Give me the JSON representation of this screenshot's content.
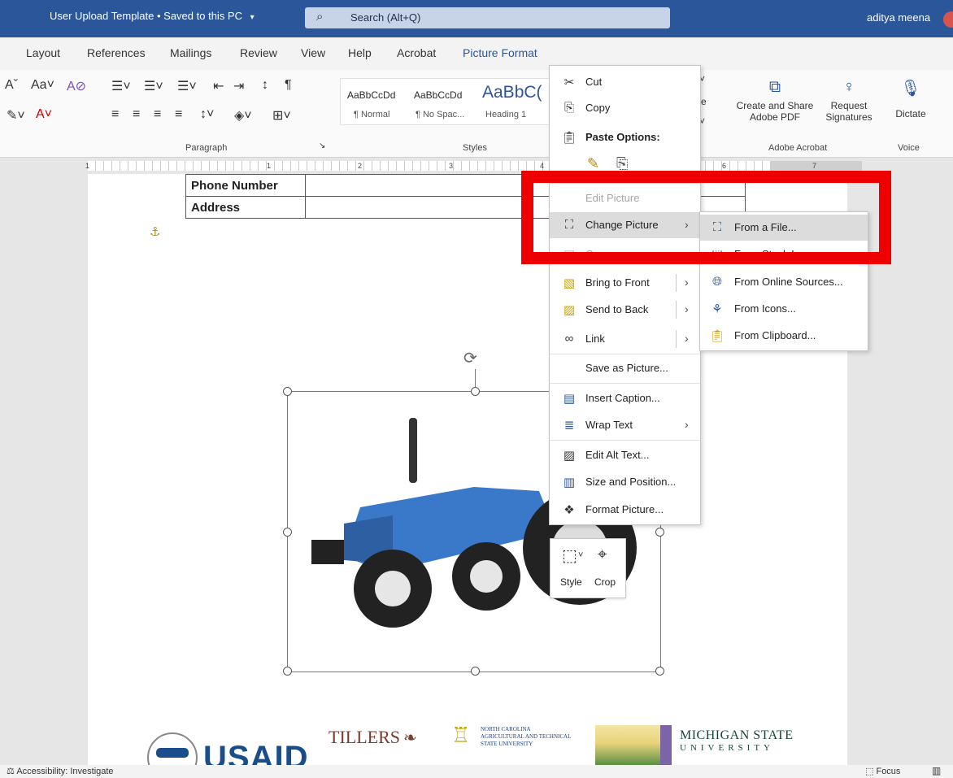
{
  "titlebar": {
    "doc_title": "User Upload Template • Saved to this PC",
    "doc_chevron": "▾",
    "search_placeholder": "Search (Alt+Q)",
    "user_name": "aditya meena"
  },
  "tabs": [
    "Layout",
    "References",
    "Mailings",
    "Review",
    "View",
    "Help",
    "Acrobat",
    "Picture Format"
  ],
  "ribbon": {
    "groups": {
      "paragraph": "Paragraph",
      "styles": "Styles",
      "adobe": "Adobe Acrobat",
      "voice": "Voice"
    },
    "styles": [
      {
        "preview": "AaBbCcDd",
        "name": "¶ Normal"
      },
      {
        "preview": "AaBbCcDd",
        "name": "¶ No Spac..."
      },
      {
        "preview": "AaBbC(",
        "name": "Heading 1"
      }
    ],
    "adobe": {
      "create_line1": "Create and Share",
      "create_line2": "Adobe PDF",
      "request_line1": "Request",
      "request_line2": "Signatures"
    },
    "voice": {
      "dictate": "Dictate"
    }
  },
  "ruler": {
    "numbers": [
      "1",
      "1",
      "2",
      "3",
      "4",
      "6",
      "7"
    ]
  },
  "document": {
    "table_rows": [
      "Phone Number",
      "Address"
    ]
  },
  "context_menu": {
    "cut": "Cut",
    "copy": "Copy",
    "paste_options": "Paste Options:",
    "edit_picture": "Edit Picture",
    "change_picture": "Change Picture",
    "group": "Group",
    "bring_to_front": "Bring to Front",
    "send_to_back": "Send to Back",
    "link": "Link",
    "save_as_picture": "Save as Picture...",
    "insert_caption": "Insert Caption...",
    "wrap_text": "Wrap Text",
    "edit_alt_text": "Edit Alt Text...",
    "size_and_position": "Size and Position...",
    "format_picture": "Format Picture..."
  },
  "submenu": {
    "from_file": "From a File...",
    "from_stock": "From Stock Images...",
    "from_online": "From Online Sources...",
    "from_icons": "From Icons...",
    "from_clipboard": "From Clipboard..."
  },
  "mini_toolbar": {
    "style": "Style",
    "crop": "Crop"
  },
  "logos": {
    "usaid": "USAID",
    "tillers": "TILLERS",
    "ncat_line1": "North Carolina",
    "ncat_line2": "Agricultural and Technical",
    "ncat_line3": "State University",
    "msu_line1": "MICHIGAN STATE",
    "msu_line2": "UNIVERSITY"
  },
  "statusbar": {
    "accessibility": "Accessibility: Investigate",
    "focus": "Focus"
  },
  "colors": {
    "word_blue": "#2b579a",
    "highlight_red": "#ee0000",
    "tractor_blue": "#3a78c9"
  }
}
